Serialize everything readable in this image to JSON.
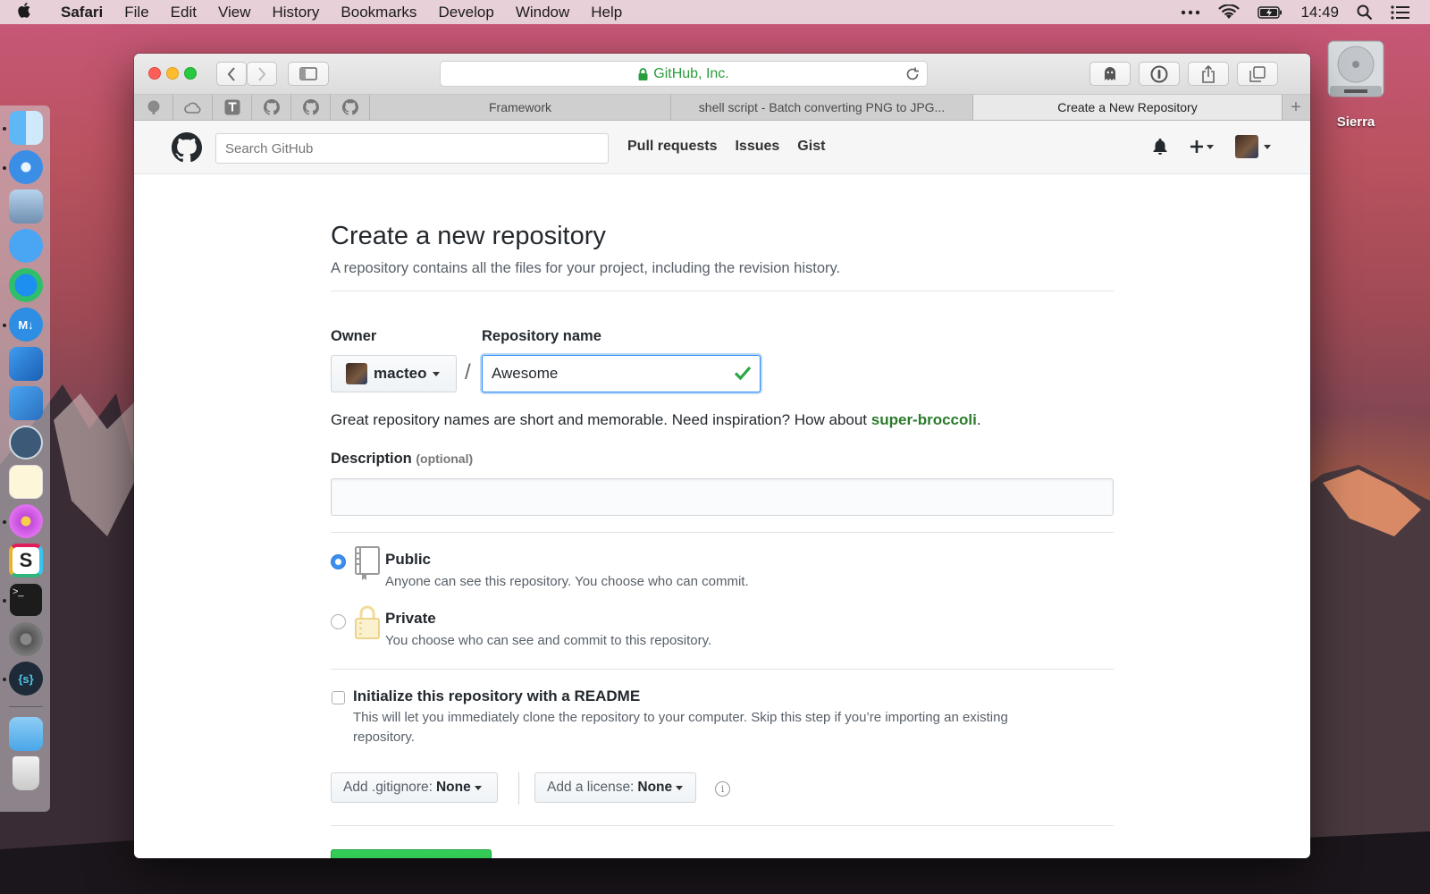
{
  "menubar": {
    "app_name": "Safari",
    "items": [
      "File",
      "Edit",
      "View",
      "History",
      "Bookmarks",
      "Develop",
      "Window",
      "Help"
    ],
    "clock": "14:49"
  },
  "desktop": {
    "drive_label": "Sierra"
  },
  "browser": {
    "url_display": "GitHub, Inc.",
    "tabs": [
      {
        "title": "Framework",
        "active": false
      },
      {
        "title": "shell script - Batch converting PNG to JPG...",
        "active": false
      },
      {
        "title": "Create a New Repository",
        "active": true
      }
    ]
  },
  "github": {
    "search_placeholder": "Search GitHub",
    "nav": [
      "Pull requests",
      "Issues",
      "Gist"
    ]
  },
  "form": {
    "title": "Create a new repository",
    "subtitle": "A repository contains all the files for your project, including the revision history.",
    "owner_label": "Owner",
    "owner_value": "macteo",
    "slash": "/",
    "repo_label": "Repository name",
    "repo_value": "Awesome",
    "hint_prefix": "Great repository names are short and memorable. Need inspiration? How about ",
    "hint_suggestion": "super-broccoli",
    "hint_suffix": ".",
    "description_label": "Description",
    "description_optional": "(optional)",
    "description_value": "",
    "visibility": {
      "public_title": "Public",
      "public_desc": "Anyone can see this repository. You choose who can commit.",
      "private_title": "Private",
      "private_desc": "You choose who can see and commit to this repository.",
      "selected": "public"
    },
    "readme": {
      "title": "Initialize this repository with a README",
      "desc_line1": "This will let you immediately clone the repository to your computer. Skip this step if you’re importing an existing",
      "desc_line2": "repository.",
      "checked": false
    },
    "gitignore_label": "Add .gitignore:",
    "gitignore_value": "None",
    "license_label": "Add a license:",
    "license_value": "None",
    "info_glyph": "i"
  },
  "colors": {
    "accent_blue": "#2188ff",
    "success_green": "#28a745",
    "suggestion_green": "#2b7a2b"
  }
}
